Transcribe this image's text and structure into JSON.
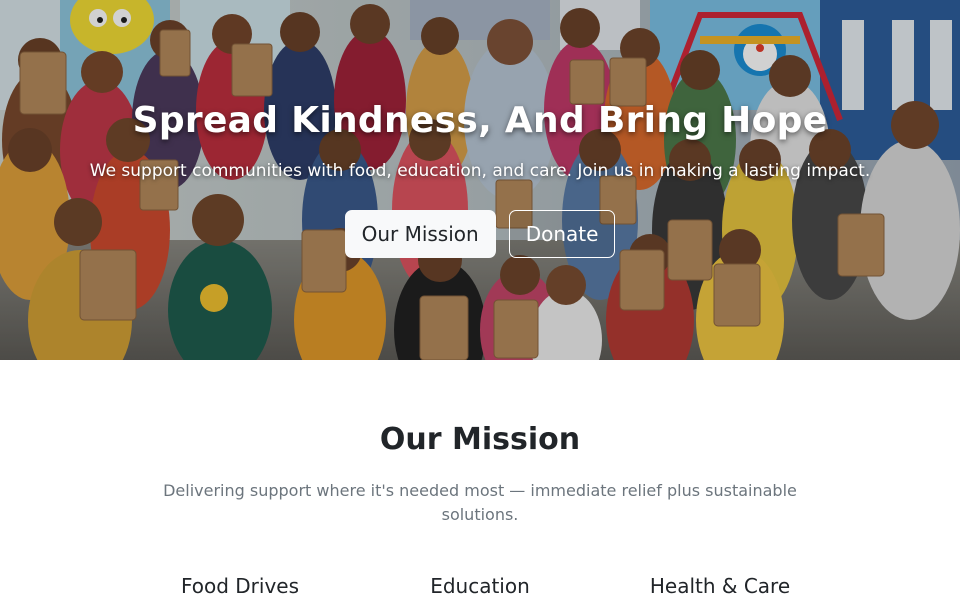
{
  "hero": {
    "title": "Spread Kindness, And Bring Hope",
    "subtitle": "We support communities with food, education, and care. Join us in making a lasting impact.",
    "buttons": {
      "mission_label": "Our Mission",
      "donate_label": "Donate"
    },
    "photo_icon": "group-photo-children-with-food-packets"
  },
  "mission": {
    "title": "Our Mission",
    "lead": "Delivering support where it's needed most — immediate relief plus sustainable solutions.",
    "features": [
      {
        "title": "Food Drives"
      },
      {
        "title": "Education"
      },
      {
        "title": "Health & Care"
      }
    ]
  },
  "colors": {
    "text_dark": "#212529",
    "text_muted": "#6c757d",
    "button_light": "#f8f9fa",
    "white": "#ffffff"
  }
}
